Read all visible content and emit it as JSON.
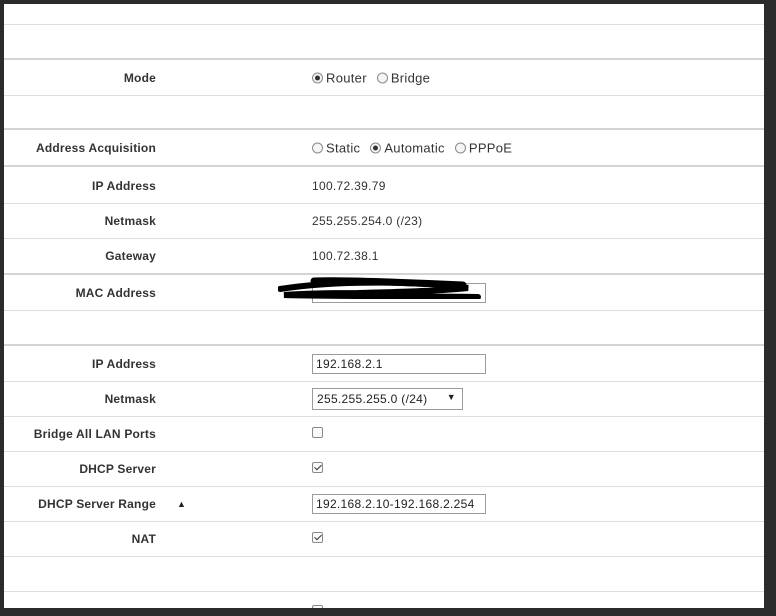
{
  "mode": {
    "label": "Mode",
    "options": [
      "Router",
      "Bridge"
    ],
    "selected": "Router"
  },
  "wan": {
    "acquisition_label": "Address Acquisition",
    "acquisition_options": [
      "Static",
      "Automatic",
      "PPPoE"
    ],
    "acquisition_selected": "Automatic",
    "ip_label": "IP Address",
    "ip_value": "100.72.39.79",
    "netmask_label": "Netmask",
    "netmask_value": "255.255.254.0 (/23)",
    "gateway_label": "Gateway",
    "gateway_value": "100.72.38.1",
    "mac_label": "MAC Address"
  },
  "lan": {
    "ip_label": "IP Address",
    "ip_value": "192.168.2.1",
    "netmask_label": "Netmask",
    "netmask_value": "255.255.255.0 (/24)",
    "bridge_label": "Bridge All LAN Ports",
    "bridge_checked": false,
    "dhcp_label": "DHCP Server",
    "dhcp_checked": true,
    "dhcp_range_label": "DHCP Server Range",
    "dhcp_range_value": "192.168.2.10-192.168.2.254",
    "nat_label": "NAT",
    "nat_checked": true
  },
  "colors": {
    "background": "#2b2b2b",
    "panel": "#ffffff",
    "label_text": "#333333"
  }
}
